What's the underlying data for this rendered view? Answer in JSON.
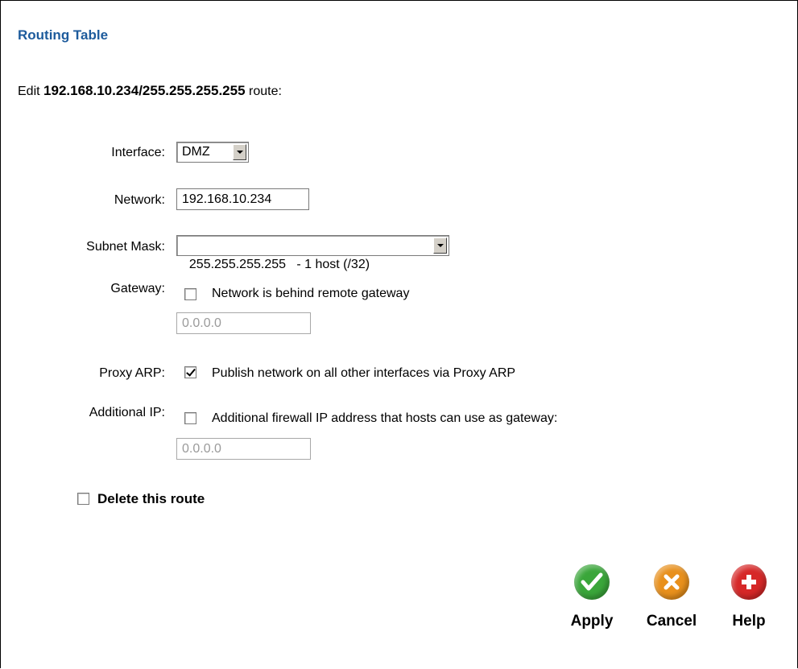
{
  "header": {
    "title": "Routing Table"
  },
  "edit": {
    "prefix": "Edit",
    "route": "192.168.10.234/255.255.255.255",
    "suffix": "route:"
  },
  "form": {
    "interface": {
      "label": "Interface:",
      "value": "DMZ"
    },
    "network": {
      "label": "Network:",
      "value": "192.168.10.234"
    },
    "subnet_mask": {
      "label": "Subnet Mask:",
      "value": "255.255.255.255   - 1 host (/32)"
    },
    "gateway": {
      "label": "Gateway:",
      "checkbox_label": "Network is behind remote gateway",
      "checked": false,
      "value": "0.0.0.0"
    },
    "proxy_arp": {
      "label": "Proxy ARP:",
      "checkbox_label": "Publish network on all other interfaces via Proxy ARP",
      "checked": true
    },
    "additional_ip": {
      "label": "Additional IP:",
      "checkbox_label": "Additional firewall IP address that hosts can use as gateway:",
      "checked": false,
      "value": "0.0.0.0"
    },
    "delete": {
      "label": "Delete this route",
      "checked": false
    }
  },
  "buttons": {
    "apply": {
      "label": "Apply",
      "icon": "checkmark-icon",
      "color": "#3aa63a"
    },
    "cancel": {
      "label": "Cancel",
      "icon": "x-icon",
      "color": "#e8901c"
    },
    "help": {
      "label": "Help",
      "icon": "plus-icon",
      "color": "#d62828"
    }
  }
}
